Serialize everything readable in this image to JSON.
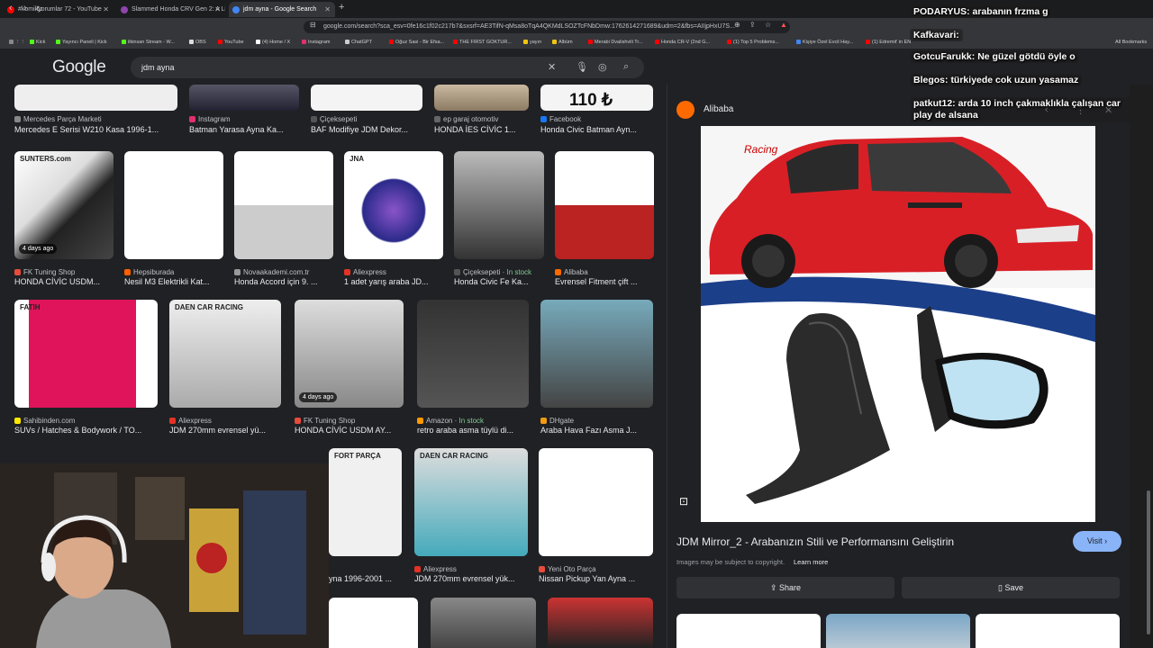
{
  "tabs": [
    {
      "title": "#komikyorumlar 72 - YouTube",
      "color": "#ff0000"
    },
    {
      "title": "Slammed Honda CRV Gen 2: A Lifest",
      "color": "#8e44ad"
    },
    {
      "title": "jdm ayna - Google Search",
      "color": "#4285f4"
    }
  ],
  "address": "google.com/search?sca_esv=0fe16c1f02c217b7&sxsrf=AE3TifN-qMsa8oTqA4QKMdLSOZTcFNbDmw:1762614271689&udm=2&fbs=AIIjpHxU7S...",
  "bookmarks": [
    {
      "label": "Kick",
      "color": "#53fc18"
    },
    {
      "label": "Yayıncı Paneli | Kick",
      "color": "#53fc18"
    },
    {
      "label": "ilkinsan Stream - W...",
      "color": "#53fc18"
    },
    {
      "label": "OBS",
      "color": "#ddd"
    },
    {
      "label": "YouTube",
      "color": "#ff0000"
    },
    {
      "label": "(4) Home / X",
      "color": "#fff"
    },
    {
      "label": "Instagram",
      "color": "#e1306c"
    },
    {
      "label": "ChatGPT",
      "color": "#ccc"
    },
    {
      "label": "Oğuz Sasi - Bir Efsa...",
      "color": "#ff0000"
    },
    {
      "label": "THE FIRST GOKTUR...",
      "color": "#ff0000"
    },
    {
      "label": "yayın",
      "color": "#f1c40f"
    },
    {
      "label": "Albüm",
      "color": "#f1c40f"
    },
    {
      "label": "Merabi Dvalishvili Tr...",
      "color": "#ff0000"
    },
    {
      "label": "Honda CR-V (2nd G...",
      "color": "#ff0000"
    },
    {
      "label": "(1) Top 5 Problems...",
      "color": "#ff0000"
    },
    {
      "label": "Kişiye Özel Evcil Hay...",
      "color": "#4285f4"
    },
    {
      "label": "(1) Edremit' in EN",
      "color": "#ff0000"
    }
  ],
  "all_bookmarks": "All Bookmarks",
  "logo": "Google",
  "query": "jdm ayna",
  "row1": [
    {
      "src": "Mercedes Parça Marketi",
      "title": "Mercedes E Serisi W210 Kasa 1996-1...",
      "color": "#888"
    },
    {
      "src": "Instagram",
      "title": "Batman Yarasa Ayna Ka...",
      "color": "#e1306c"
    },
    {
      "src": "Çiçeksepeti",
      "title": "BAF Modifiye JDM Dekor...",
      "color": "#555"
    },
    {
      "src": "ep garaj otomotiv",
      "title": "HONDA İES CİVİC 1...",
      "color": "#666"
    },
    {
      "src": "Facebook",
      "title": "Honda Civic Batman Ayn...",
      "color": "#1877f2"
    }
  ],
  "row1_price": "110 ₺",
  "row2": [
    {
      "src": "FK Tuning Shop",
      "title": "HONDA CİVİC USDM...",
      "badge": "4 days ago",
      "color": "#e74c3c",
      "logo": "SUNTERS.com"
    },
    {
      "src": "Hepsiburada",
      "title": "Nesil M3 Elektrikli Kat...",
      "color": "#ff6000"
    },
    {
      "src": "Novaakademi.com.tr",
      "title": "Honda Accord için 9. ...",
      "color": "#999"
    },
    {
      "src": "Aliexpress",
      "title": "1 adet yarış araba JD...",
      "color": "#e43225",
      "logo": "JNA"
    },
    {
      "src": "Çiçeksepeti",
      "stock": "In stock",
      "title": "Honda Civic Fe Ka...",
      "color": "#555"
    },
    {
      "src": "Alibaba",
      "title": "Evrensel Fitment çift ...",
      "color": "#ff6a00"
    }
  ],
  "row3": [
    {
      "src": "Sahibinden.com",
      "title": "SUVs / Hatches & Bodywork / TO...",
      "color": "#ffe800",
      "logo": "FATIH"
    },
    {
      "src": "Aliexpress",
      "title": "JDM 270mm evrensel yü...",
      "color": "#e43225",
      "logo": "DAEN CAR RACING"
    },
    {
      "src": "FK Tuning Shop",
      "title": "HONDA CİVİC USDM AY...",
      "badge": "4 days ago",
      "color": "#e74c3c"
    },
    {
      "src": "Amazon",
      "stock": "In stock",
      "title": "retro araba asma tüylü di...",
      "color": "#ff9900"
    },
    {
      "src": "DHgate",
      "title": "Araba Hava Fazı Asma J...",
      "color": "#f39c12"
    }
  ],
  "row4": [
    {
      "src": "",
      "title": "yna 1996-2001 ...",
      "color": "#777",
      "logo": "FORT PARÇA"
    },
    {
      "src": "Aliexpress",
      "title": "JDM 270mm evrensel yük...",
      "color": "#e43225",
      "logo": "DAEN CAR RACING"
    },
    {
      "src": "Yeni Oto Parça",
      "title": "Nissan Pickup Yan Ayna ...",
      "color": "#e74c3c"
    }
  ],
  "panel": {
    "source": "Alibaba",
    "title": "JDM Mirror_2 - Arabanızın Stili ve Performansını Geliştirin",
    "visit": "Visit",
    "copyright": "Images may be subject to copyright.",
    "learn_more": "Learn more",
    "share": "Share",
    "save": "Save",
    "watermark": "Racing"
  },
  "chat": [
    {
      "user": "PODARYUS:",
      "text": "arabanın frzma g"
    },
    {
      "user": "Kafkavari:",
      "text": ""
    },
    {
      "user": "GotcuFarukk:",
      "text": "Ne güzel götdü öyle o"
    },
    {
      "user": "Blegos:",
      "text": "türkiyede cok uzun yasamaz"
    },
    {
      "user": "patkut12:",
      "text": "arda 10 inch çakmaklıkla çalışan car play de alsana"
    }
  ],
  "colors": {
    "bg": "#202124",
    "accent": "#8ab4f8",
    "card": "#303134"
  }
}
